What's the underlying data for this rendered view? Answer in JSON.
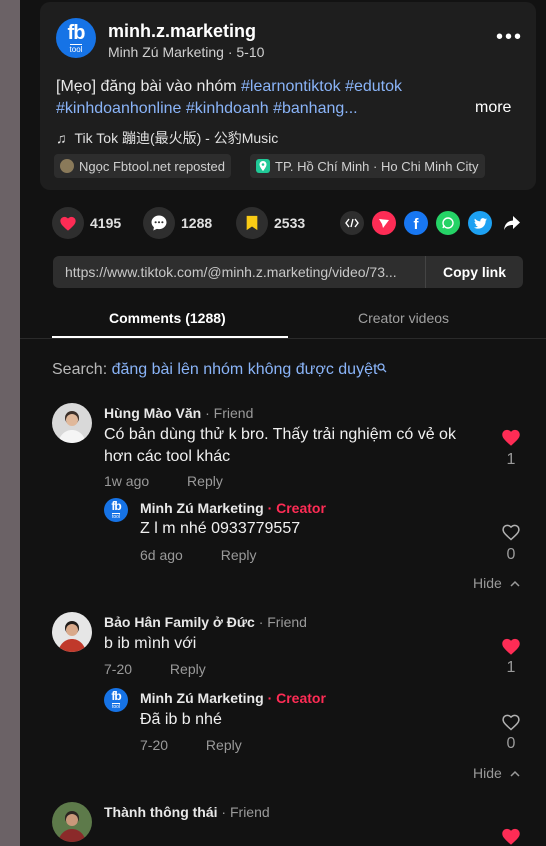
{
  "post": {
    "username": "minh.z.marketing",
    "display_name": "Minh Zú Marketing",
    "date": "5-10",
    "caption_lead": "[Mẹo] đăng bài vào nhóm ",
    "tags_line1": "#learnontiktok #edutok",
    "tags_line2": "#kinhdoanhonline #kinhdoanh #banhang...",
    "more_label": "more",
    "music_label": "Tik Tok 蹦迪(最火版) - 公豹Music",
    "repost_label": "Ngọc Fbtool.net reposted",
    "location_label": "TP. Hồ Chí Minh · Ho Chi Minh City",
    "avatar_text": "fb",
    "avatar_sub": "tool"
  },
  "stats": {
    "likes": "4195",
    "comments": "1288",
    "saves": "2533"
  },
  "share": {
    "icons": [
      "embed-icon",
      "send-icon",
      "facebook-icon",
      "whatsapp-icon",
      "twitter-icon",
      "share-arrow-icon"
    ],
    "colors": {
      "send": "#fe2c55",
      "facebook": "#1877f2",
      "whatsapp": "#25d366",
      "twitter": "#1da1f2"
    }
  },
  "link": {
    "url": "https://www.tiktok.com/@minh.z.marketing/video/73...",
    "copy_label": "Copy link"
  },
  "tabs": {
    "comments": "Comments (1288)",
    "creator_videos": "Creator videos"
  },
  "search": {
    "label": "Search:",
    "query": "đăng bài lên nhóm không được duyệt"
  },
  "comments": [
    {
      "name": "Hùng Mào Văn",
      "relation": "· Friend",
      "text": "Có bản dùng thử k bro. Thấy trải nghiệm có vẻ ok hơn các tool khác",
      "time": "1w ago",
      "reply_label": "Reply",
      "likes": "1",
      "liked": true,
      "replies": [
        {
          "name": "Minh Zú Marketing",
          "badge": "· Creator",
          "text": "Z l m nhé 0933779557",
          "time": "6d ago",
          "reply_label": "Reply",
          "likes": "0",
          "liked": false
        }
      ],
      "hide_label": "Hide"
    },
    {
      "name": "Bảo Hân Family ở Đức",
      "relation": "· Friend",
      "text": "b ib mình với",
      "time": "7-20",
      "reply_label": "Reply",
      "likes": "1",
      "liked": true,
      "replies": [
        {
          "name": "Minh Zú Marketing",
          "badge": "· Creator",
          "text": "Đã ib b nhé",
          "time": "7-20",
          "reply_label": "Reply",
          "likes": "0",
          "liked": false
        }
      ],
      "hide_label": "Hide"
    },
    {
      "name": "Thành thông thái",
      "relation": "· Friend"
    }
  ],
  "colors": {
    "accent_red": "#fe2c55",
    "link_blue": "#8ab4f8",
    "fb_blue": "#1673e6",
    "save_yellow": "#facc15"
  }
}
